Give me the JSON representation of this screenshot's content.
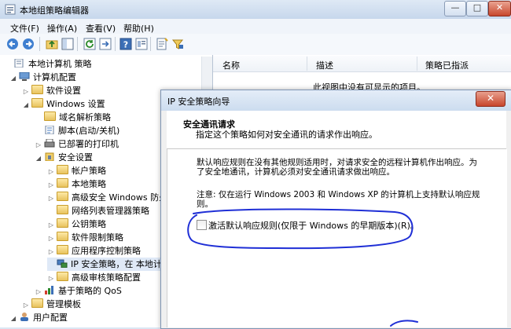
{
  "window": {
    "title": "本地组策略编辑器"
  },
  "window_controls": {
    "minimize": "—",
    "maximize": "□",
    "close": "✕"
  },
  "menu": [
    "文件(F)",
    "操作(A)",
    "查看(V)",
    "帮助(H)"
  ],
  "tree": [
    {
      "label": "本地计算机 策略",
      "icon": "computer-policy-icon",
      "toggle": ""
    },
    {
      "label": "计算机配置",
      "icon": "computer-icon",
      "toggle": "◢"
    },
    {
      "label": "软件设置",
      "icon": "folder-icon",
      "toggle": "▷"
    },
    {
      "label": "Windows 设置",
      "icon": "folder-icon",
      "toggle": "◢"
    },
    {
      "label": "域名解析策略",
      "icon": "folder-icon",
      "toggle": ""
    },
    {
      "label": "脚本(启动/关机)",
      "icon": "script-icon",
      "toggle": ""
    },
    {
      "label": "已部署的打印机",
      "icon": "printer-icon",
      "toggle": "▷"
    },
    {
      "label": "安全设置",
      "icon": "security-icon",
      "toggle": "◢"
    },
    {
      "label": "帐户策略",
      "icon": "folder-icon",
      "toggle": "▷"
    },
    {
      "label": "本地策略",
      "icon": "folder-icon",
      "toggle": "▷"
    },
    {
      "label": "高级安全 Windows 防火",
      "icon": "folder-icon",
      "toggle": "▷"
    },
    {
      "label": "网络列表管理器策略",
      "icon": "folder-icon",
      "toggle": ""
    },
    {
      "label": "公钥策略",
      "icon": "folder-icon",
      "toggle": "▷"
    },
    {
      "label": "软件限制策略",
      "icon": "folder-icon",
      "toggle": "▷"
    },
    {
      "label": "应用程序控制策略",
      "icon": "folder-icon",
      "toggle": "▷"
    },
    {
      "label": "IP 安全策略，在 本地计",
      "icon": "ipsec-icon",
      "toggle": ""
    },
    {
      "label": "高级审核策略配置",
      "icon": "folder-icon",
      "toggle": "▷"
    },
    {
      "label": "基于策略的 QoS",
      "icon": "qos-icon",
      "toggle": "▷"
    },
    {
      "label": "管理模板",
      "icon": "folder-icon",
      "toggle": "▷"
    },
    {
      "label": "用户配置",
      "icon": "user-icon",
      "toggle": "◢"
    }
  ],
  "list": {
    "columns": [
      "名称",
      "描述",
      "策略已指派"
    ],
    "empty_message": "此视图中没有可显示的项目。"
  },
  "dialog": {
    "title": "IP 安全策略向导",
    "heading": "安全通讯请求",
    "subheading": "指定这个策略如何对安全通讯的请求作出响应。",
    "paragraph1_line1": "默认响应规则在没有其他规则适用时，对请求安全的远程计算机作出响应。为",
    "paragraph1_line2": "了安全地通讯，计算机必须对安全通讯请求做出响应。",
    "paragraph2_line1": "注意: 仅在运行 Windows 2003 和 Windows XP 的计算机上支持默认响应规",
    "paragraph2_line2": "则。",
    "checkbox_label": "激活默认响应规则(仅限于 Windows 的早期版本)(R)。",
    "checkbox_checked": false,
    "annotation_color": "#1f2fd6"
  }
}
